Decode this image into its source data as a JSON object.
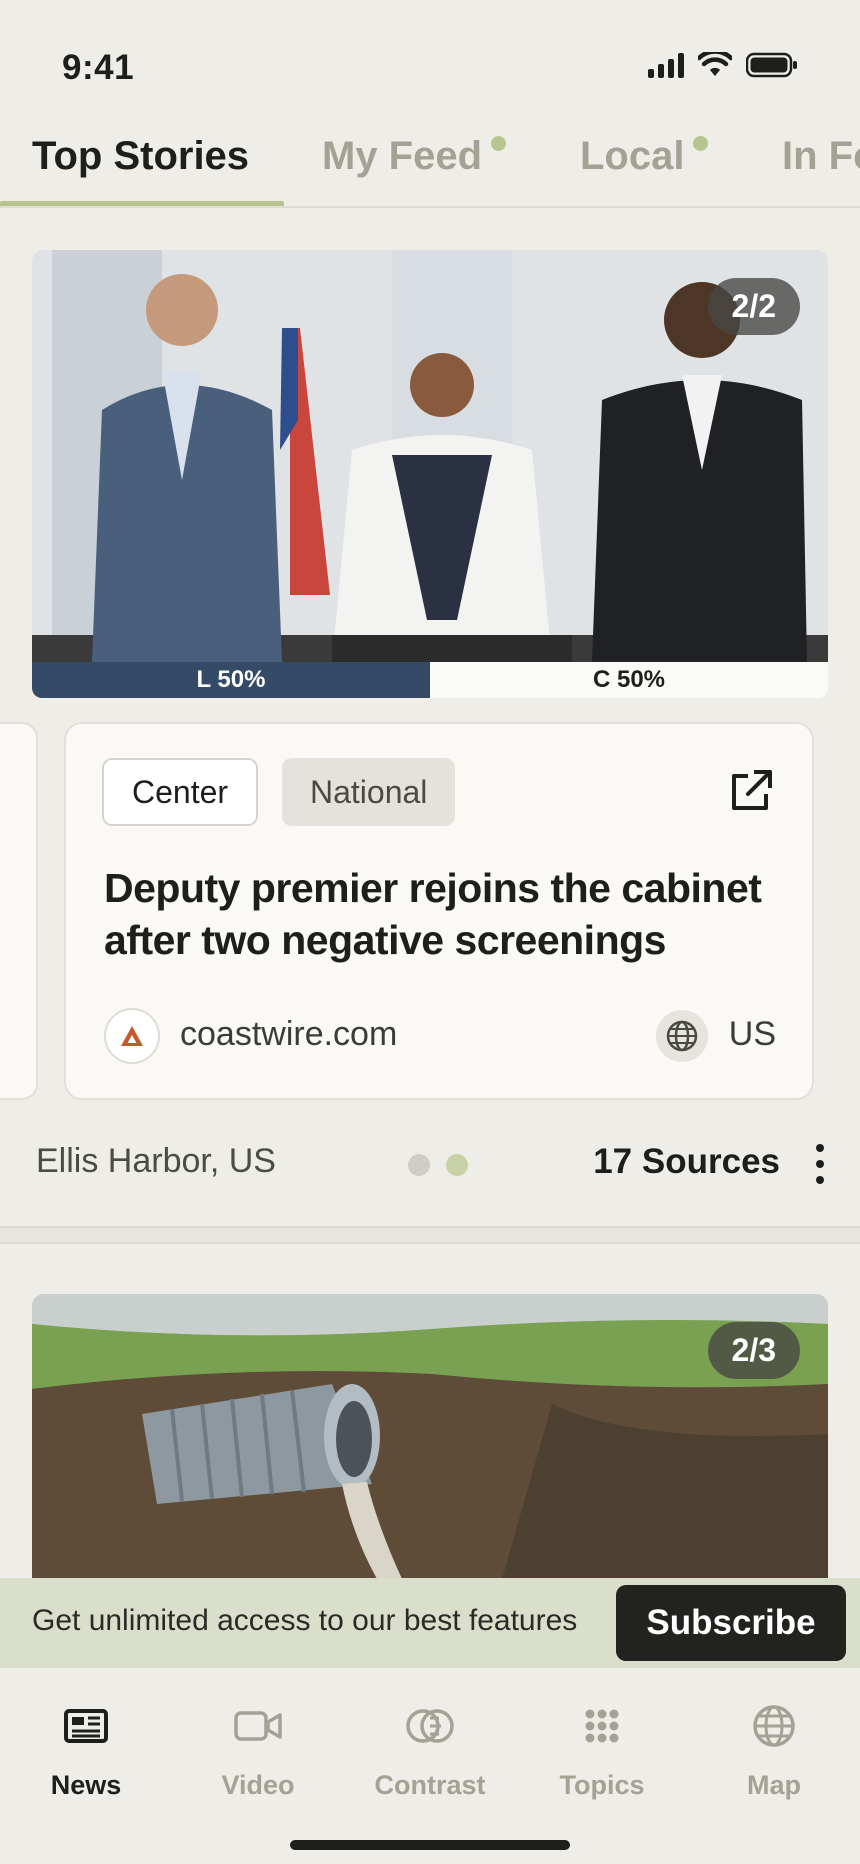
{
  "status_bar": {
    "time": "9:41"
  },
  "tabs": [
    {
      "label": "Top Stories",
      "active": true,
      "dot": false
    },
    {
      "label": "My Feed",
      "active": false,
      "dot": true
    },
    {
      "label": "Local",
      "active": false,
      "dot": true
    },
    {
      "label": "In Fo",
      "active": false,
      "dot": false
    }
  ],
  "story1": {
    "image_counter": "2/2",
    "bias_left_label": "L 50%",
    "bias_right_label": "C 50%",
    "bias_left_fraction": 0.5,
    "tags": {
      "bias": "Center",
      "scope": "National"
    },
    "headline": "Deputy premier rejoins the cabinet after two negative screenings",
    "source": "coastwire.com",
    "country": "US",
    "location": "Ellis Harbor, US",
    "sources_count": "17 Sources",
    "pager_total": 2,
    "pager_active": 2
  },
  "story2": {
    "image_counter": "2/3"
  },
  "banner": {
    "text": "Get unlimited access to our best features",
    "button": "Subscribe"
  },
  "bottom_nav": [
    {
      "label": "News",
      "icon": "newspaper-icon",
      "active": true
    },
    {
      "label": "Video",
      "icon": "video-camera-icon",
      "active": false
    },
    {
      "label": "Contrast",
      "icon": "contrast-icon",
      "active": false
    },
    {
      "label": "Topics",
      "icon": "grid-dots-icon",
      "active": false
    },
    {
      "label": "Map",
      "icon": "globe-icon",
      "active": false
    }
  ],
  "colors": {
    "background": "#efede8",
    "accent": "#b8c48f",
    "bias_left": "#344a66",
    "banner_bg": "#dadfcb"
  }
}
